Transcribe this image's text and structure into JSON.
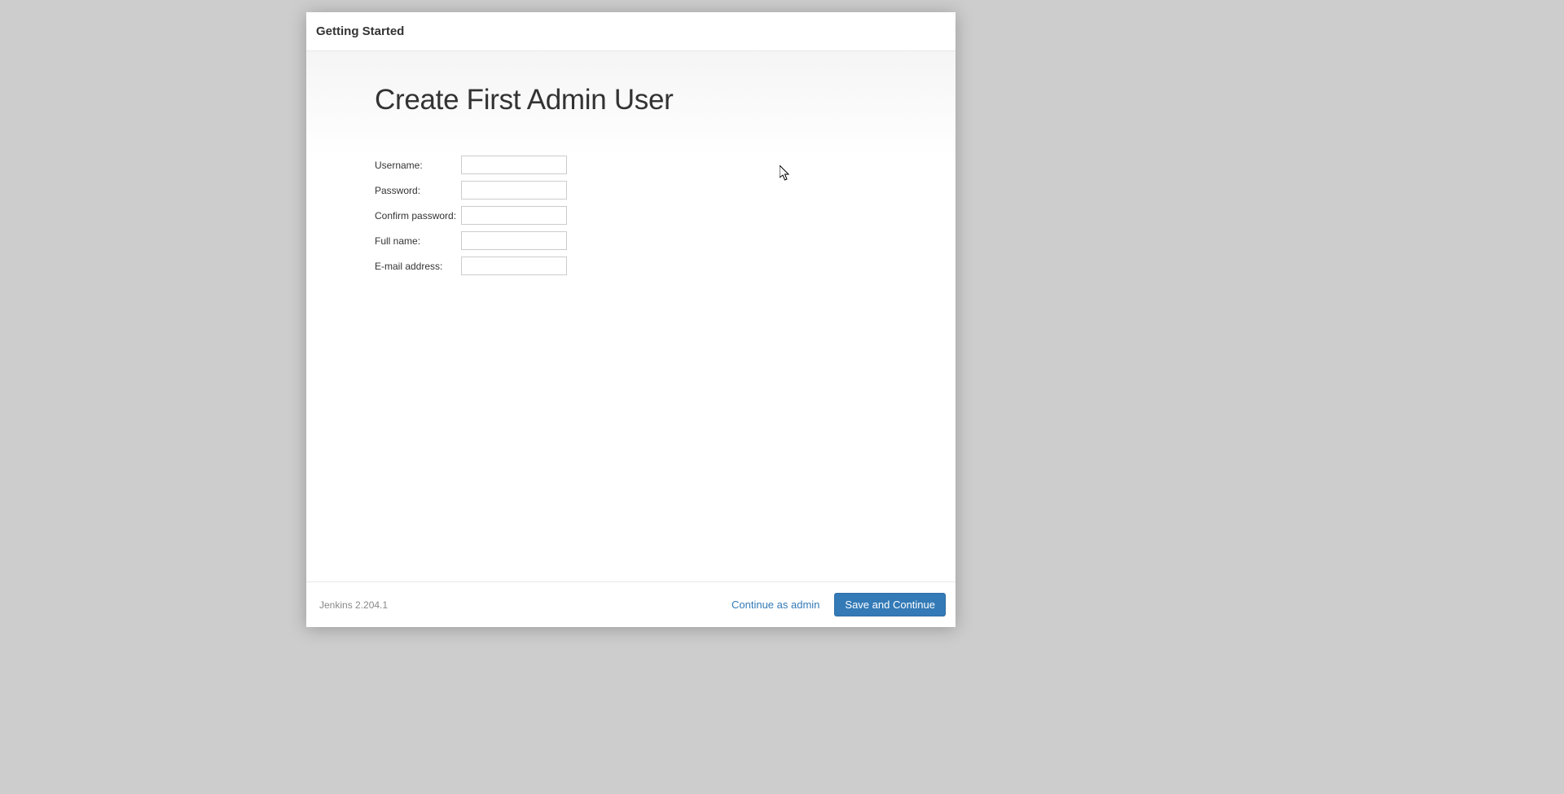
{
  "header": {
    "title": "Getting Started"
  },
  "main": {
    "title": "Create First Admin User"
  },
  "form": {
    "username": {
      "label": "Username:",
      "value": ""
    },
    "password": {
      "label": "Password:",
      "value": ""
    },
    "confirm_password": {
      "label": "Confirm password:",
      "value": ""
    },
    "full_name": {
      "label": "Full name:",
      "value": ""
    },
    "email": {
      "label": "E-mail address:",
      "value": ""
    }
  },
  "footer": {
    "version": "Jenkins 2.204.1",
    "continue_as_admin": "Continue as admin",
    "save_and_continue": "Save and Continue"
  }
}
